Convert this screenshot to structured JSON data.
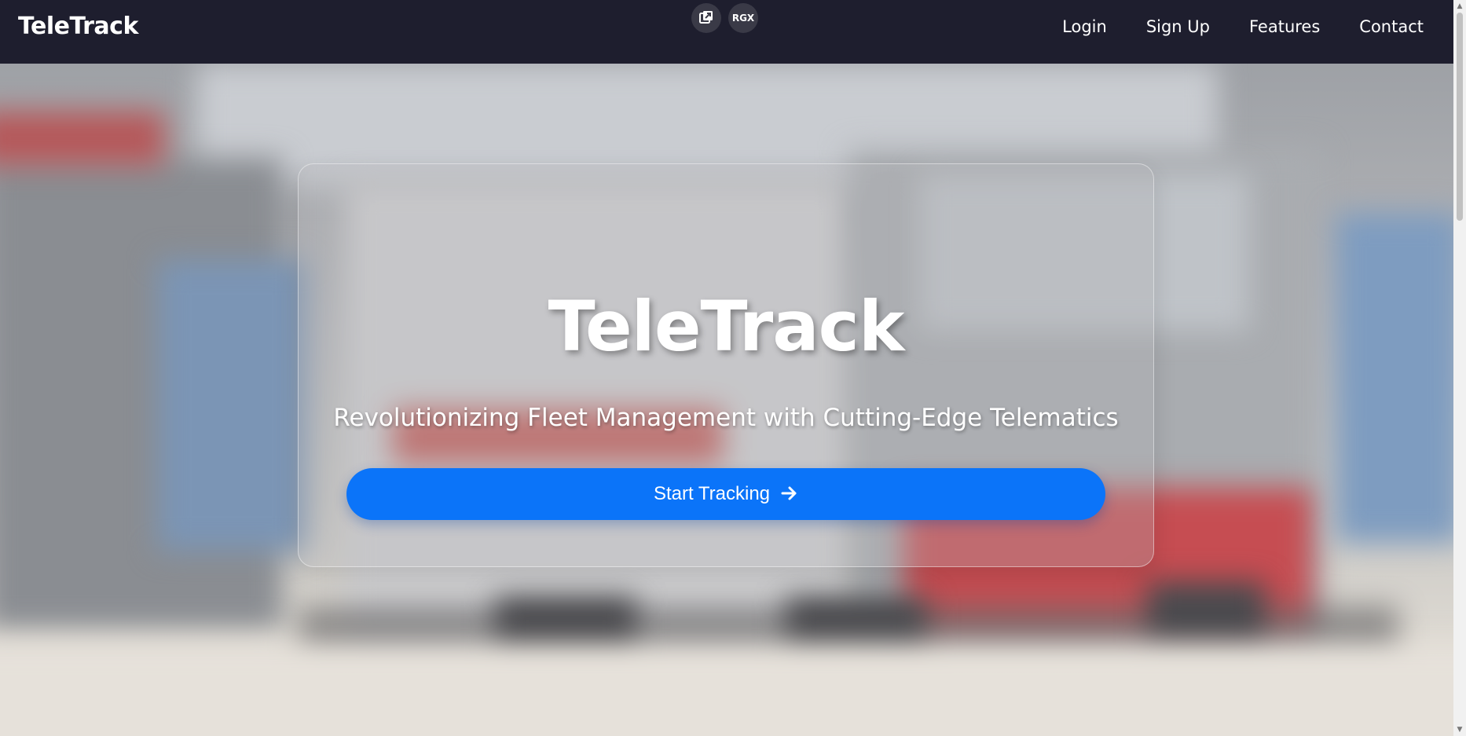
{
  "header": {
    "brand": "TeleTrack",
    "tools": [
      {
        "label": "",
        "icon": "external-window-icon"
      },
      {
        "label": "RGX",
        "icon": "rgx-badge-icon"
      }
    ],
    "nav": [
      "Login",
      "Sign Up",
      "Features",
      "Contact"
    ]
  },
  "hero": {
    "title": "TeleTrack",
    "subtitle": "Revolutionizing Fleet Management with Cutting-Edge Telematics",
    "cta_label": "Start Tracking",
    "cta_icon": "arrow-right-icon"
  },
  "colors": {
    "nav_bg": "#1e1e2e",
    "accent": "#0b74f9",
    "text": "#ffffff"
  }
}
